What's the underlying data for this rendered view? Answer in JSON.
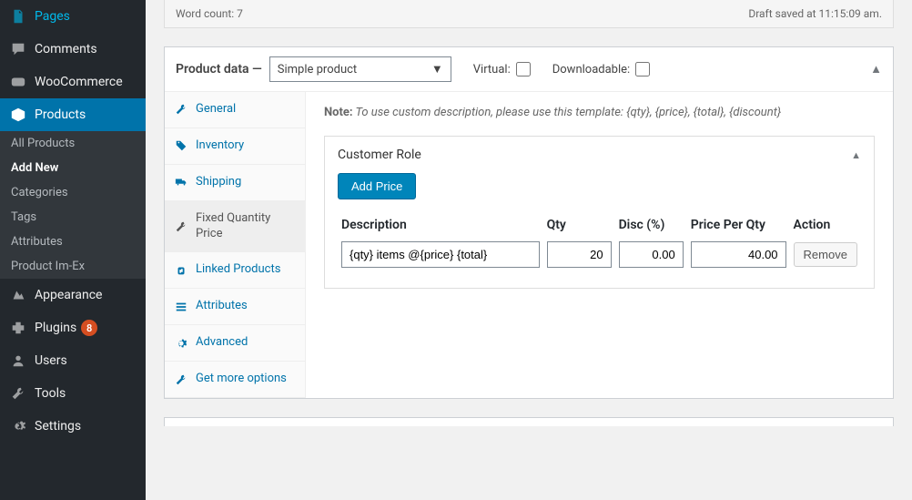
{
  "sidebar": {
    "items": [
      {
        "label": "Pages",
        "icon": "pages"
      },
      {
        "label": "Comments",
        "icon": "comments"
      },
      {
        "label": "WooCommerce",
        "icon": "woo"
      },
      {
        "label": "Products",
        "icon": "products",
        "active": true
      },
      {
        "label": "Appearance",
        "icon": "appearance"
      },
      {
        "label": "Plugins",
        "icon": "plugins",
        "badge": "8"
      },
      {
        "label": "Users",
        "icon": "users"
      },
      {
        "label": "Tools",
        "icon": "tools"
      },
      {
        "label": "Settings",
        "icon": "settings"
      }
    ],
    "submenu": [
      {
        "label": "All Products"
      },
      {
        "label": "Add New",
        "active": true
      },
      {
        "label": "Categories"
      },
      {
        "label": "Tags"
      },
      {
        "label": "Attributes"
      },
      {
        "label": "Product Im-Ex"
      }
    ]
  },
  "wordcount": {
    "label": "Word count: 7",
    "status": "Draft saved at 11:15:09 am."
  },
  "product_data": {
    "title": "Product data —",
    "type_selected": "Simple product",
    "virtual_label": "Virtual:",
    "downloadable_label": "Downloadable:"
  },
  "tabs": [
    {
      "label": "General",
      "icon": "wrench"
    },
    {
      "label": "Inventory",
      "icon": "tag"
    },
    {
      "label": "Shipping",
      "icon": "truck"
    },
    {
      "label": "Fixed Quantity Price",
      "icon": "wrench",
      "active": true
    },
    {
      "label": "Linked Products",
      "icon": "link"
    },
    {
      "label": "Attributes",
      "icon": "list"
    },
    {
      "label": "Advanced",
      "icon": "gear"
    },
    {
      "label": "Get more options",
      "icon": "more"
    }
  ],
  "content": {
    "note_bold": "Note:",
    "note_text": " To use custom description, please use this template: {qty}, {price}, {total}, {discount}",
    "role_title": "Customer Role",
    "add_price_label": "Add Price",
    "headers": {
      "description": "Description",
      "qty": "Qty",
      "disc": "Disc (%)",
      "price_per_qty": "Price Per Qty",
      "action": "Action"
    },
    "row": {
      "description": "{qty} items @{price} {total}",
      "qty": "20",
      "disc": "0.00",
      "price_per_qty": "40.00",
      "remove_label": "Remove"
    }
  }
}
